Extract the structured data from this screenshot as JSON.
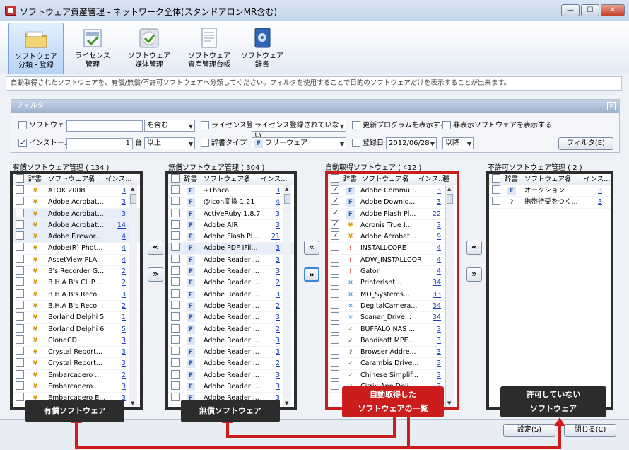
{
  "window": {
    "title": "ソフトウェア資産管理 - ネットワーク全体(スタンドアロンMR含む)"
  },
  "toolbar": [
    {
      "label1": "ソフトウェア",
      "label2": "分類・登録"
    },
    {
      "label1": "ライセンス",
      "label2": "管理"
    },
    {
      "label1": "ソフトウェア",
      "label2": "媒体管理"
    },
    {
      "label1": "ソフトウェア",
      "label2": "資産管理台帳"
    },
    {
      "label1": "ソフトウェア",
      "label2": "辞書"
    }
  ],
  "info_text": "自動取得されたソフトウェアを、有償/無償/不許可ソフトウェアへ分類してください。フィルタを使用することで目的のソフトウェアだけを表示することが出来ます。",
  "filter": {
    "title": "フィルタ",
    "sw_name_label": "ソフトウェア名",
    "sw_name_value": "",
    "sw_name_mode": "を含む",
    "license_label": "ライセンス登録",
    "license_value": "ライセンス登録されていない",
    "update_label": "更新プログラムを表示する",
    "hidden_label": "非表示ソフトウェアを表示する",
    "install_label": "インストール数",
    "install_value": "1",
    "install_unit": "台",
    "install_mode": "以上",
    "dict_label": "辞書タイプ",
    "dict_value": "フリーウェア",
    "date_label": "登録日",
    "date_value": "2012/06/28",
    "date_mode": "以降",
    "filter_button": "フィルタ(E)"
  },
  "panels": {
    "paid": {
      "title": "有償ソフトウェア管理 ( 134 )"
    },
    "free": {
      "title": "無償ソフトウェア管理 ( 304 )"
    },
    "auto": {
      "title": "自動取得ソフトウェア ( 412 )"
    },
    "deny": {
      "title": "不許可ソフトウェア管理 ( 2 )"
    }
  },
  "columns": {
    "dict": "辞書",
    "name": "ソフトウェア名",
    "sort": "/",
    "install": "インス...",
    "install_short": "インス...",
    "extra": "種"
  },
  "paid_rows": [
    {
      "name": "ATOK 2008",
      "count": "3"
    },
    {
      "name": "Adobe Acrobat...",
      "count": "3"
    },
    {
      "name": "Adobe Acrobat...",
      "count": "3"
    },
    {
      "name": "Adobe Acrobat...",
      "count": "14"
    },
    {
      "name": "Adobe Firewor...",
      "count": "4"
    },
    {
      "name": "Adobe(R) Phot...",
      "count": "4"
    },
    {
      "name": "AssetView PLA...",
      "count": "4"
    },
    {
      "name": "B's Recorder G...",
      "count": "2"
    },
    {
      "name": "B.H.A B's CLiP ...",
      "count": "2"
    },
    {
      "name": "B.H.A B's Reco...",
      "count": "3"
    },
    {
      "name": "B.H.A B's Reco...",
      "count": "2"
    },
    {
      "name": "Borland Delphi 5",
      "count": "1"
    },
    {
      "name": "Borland Delphi 6",
      "count": "5"
    },
    {
      "name": "CloneCD",
      "count": "3"
    },
    {
      "name": "Crystal Report...",
      "count": "3"
    },
    {
      "name": "Crystal Report...",
      "count": "3"
    },
    {
      "name": "Embarcadero ...",
      "count": "2"
    },
    {
      "name": "Embarcadero ...",
      "count": "3"
    },
    {
      "name": "Embarcadero E...",
      "count": "3"
    }
  ],
  "free_rows": [
    {
      "name": "+Lhaca",
      "count": "3"
    },
    {
      "name": "@icon変換 1.21",
      "count": "4"
    },
    {
      "name": "ActiveRuby 1.8.7",
      "count": "3"
    },
    {
      "name": "Adobe AIR",
      "count": "3"
    },
    {
      "name": "Adobe Flash Pl...",
      "count": "21"
    },
    {
      "name": "Adobe PDF IFil...",
      "count": "3"
    },
    {
      "name": "Adobe Reader ...",
      "count": "3"
    },
    {
      "name": "Adobe Reader ...",
      "count": "3"
    },
    {
      "name": "Adobe Reader ...",
      "count": "2"
    },
    {
      "name": "Adobe Reader ...",
      "count": "3"
    },
    {
      "name": "Adobe Reader ...",
      "count": "2"
    },
    {
      "name": "Adobe Reader ...",
      "count": "3"
    },
    {
      "name": "Adobe Reader ...",
      "count": "2"
    },
    {
      "name": "Adobe Reader ...",
      "count": "3"
    },
    {
      "name": "Adobe Reader ...",
      "count": "3"
    },
    {
      "name": "Adobe Reader ...",
      "count": "2"
    },
    {
      "name": "Adobe Reader ...",
      "count": "3"
    },
    {
      "name": "Adobe Reader ...",
      "count": "3"
    },
    {
      "name": "Adobe Reader ...",
      "count": "3"
    }
  ],
  "auto_rows": [
    {
      "name": "Adobe Commu...",
      "count": "3",
      "checked": true,
      "icon": "F"
    },
    {
      "name": "Adobe Downlo...",
      "count": "3",
      "checked": true,
      "icon": "F"
    },
    {
      "name": "Adobe Flash Pl...",
      "count": "22",
      "checked": true,
      "icon": "F"
    },
    {
      "name": "Acronis True I...",
      "count": "3",
      "checked": true,
      "icon": "¥"
    },
    {
      "name": "Adobe Acrobat...",
      "count": "9",
      "checked": true,
      "icon": "¥"
    },
    {
      "name": "INSTALLCORE",
      "count": "4",
      "checked": false,
      "icon": "!"
    },
    {
      "name": "ADW_INSTALLCOR",
      "count": "4",
      "checked": false,
      "icon": "!"
    },
    {
      "name": "Gator",
      "count": "4",
      "checked": false,
      "icon": "!"
    },
    {
      "name": "PrinterIsnt...",
      "count": "34",
      "checked": false,
      "icon": "✕"
    },
    {
      "name": "MO_Systems...",
      "count": "33",
      "checked": false,
      "icon": "✕"
    },
    {
      "name": "DegitalCamera...",
      "count": "34",
      "checked": false,
      "icon": "✕"
    },
    {
      "name": "Scanar_Drive...",
      "count": "34",
      "checked": false,
      "icon": "✕"
    },
    {
      "name": "BUFFALO NAS ...",
      "count": "3",
      "checked": false,
      "icon": "✓"
    },
    {
      "name": "Bandisoft MPE...",
      "count": "3",
      "checked": false,
      "icon": "✓"
    },
    {
      "name": "Browser Addre...",
      "count": "3",
      "checked": false,
      "icon": "?"
    },
    {
      "name": "Carambis Drive...",
      "count": "3",
      "checked": false,
      "icon": "✓"
    },
    {
      "name": "Chinese Simplif...",
      "count": "3",
      "checked": false,
      "icon": "✓"
    },
    {
      "name": "Citrix App Deli...",
      "count": "3",
      "checked": false,
      "icon": "✓"
    }
  ],
  "deny_rows": [
    {
      "name": "オークション",
      "count": "3",
      "icon": "F"
    },
    {
      "name": "携帯待受をつく...",
      "count": "3",
      "icon": "?"
    }
  ],
  "move_buttons": {
    "left": "«",
    "right": "»"
  },
  "callouts": {
    "paid": "有償ソフトウェア",
    "free": "無償ソフトウェア",
    "auto1": "自動取得した",
    "auto2": "ソフトウェアの一覧",
    "deny1": "許可していない",
    "deny2": "ソフトウェア"
  },
  "buttons": {
    "settings": "設定(S)",
    "close": "閉じる(C)"
  },
  "colors": {
    "accent_red": "#cc1d1d",
    "link_blue": "#1b3fc9"
  }
}
